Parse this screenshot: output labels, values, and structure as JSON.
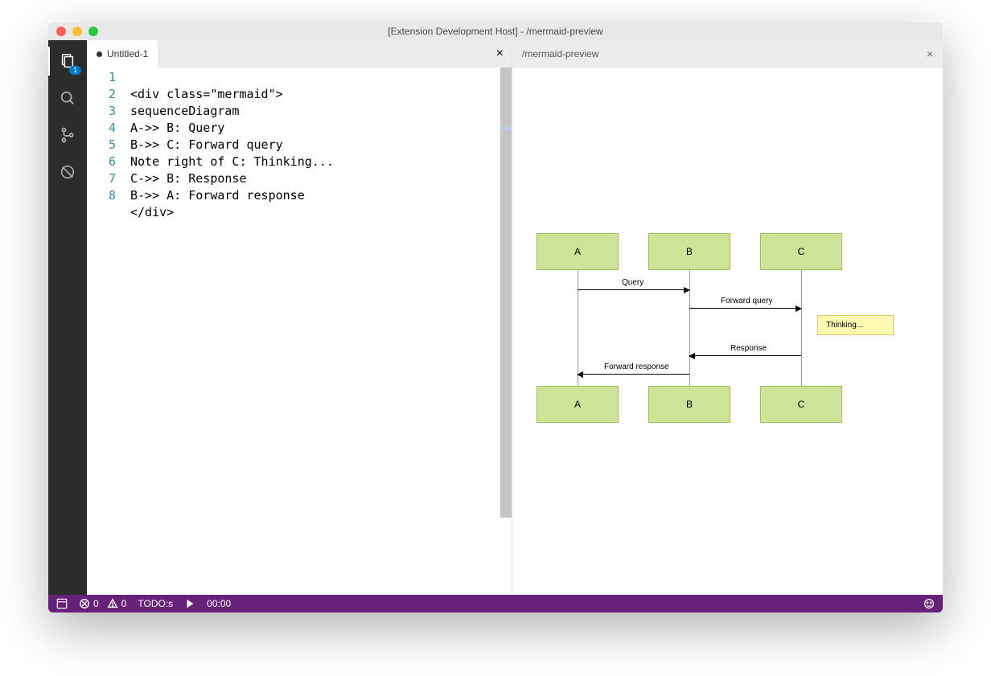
{
  "window": {
    "title": "[Extension Development Host] - /mermaid-preview"
  },
  "activitybar": {
    "explorer_badge": "1"
  },
  "tabs": {
    "left": {
      "label": "Untitled-1",
      "dirty": true
    },
    "right": {
      "label": "/mermaid-preview"
    }
  },
  "editor": {
    "line_numbers": [
      "1",
      "2",
      "3",
      "4",
      "5",
      "6",
      "7",
      "8"
    ],
    "lines": [
      "<div class=\"mermaid\">",
      "sequenceDiagram",
      "A->> B: Query",
      "B->> C: Forward query",
      "Note right of C: Thinking...",
      "C->> B: Response",
      "B->> A: Forward response",
      "</div>"
    ]
  },
  "chart_data": {
    "type": "sequence-diagram",
    "actors": [
      "A",
      "B",
      "C"
    ],
    "messages": [
      {
        "from": "A",
        "to": "B",
        "label": "Query"
      },
      {
        "from": "B",
        "to": "C",
        "label": "Forward query"
      },
      {
        "type": "note",
        "of": "C",
        "position": "right",
        "label": "Thinking..."
      },
      {
        "from": "C",
        "to": "B",
        "label": "Response"
      },
      {
        "from": "B",
        "to": "A",
        "label": "Forward response"
      }
    ]
  },
  "statusbar": {
    "errors": "0",
    "warnings": "0",
    "todo": "TODO:s",
    "timer": "00:00"
  }
}
